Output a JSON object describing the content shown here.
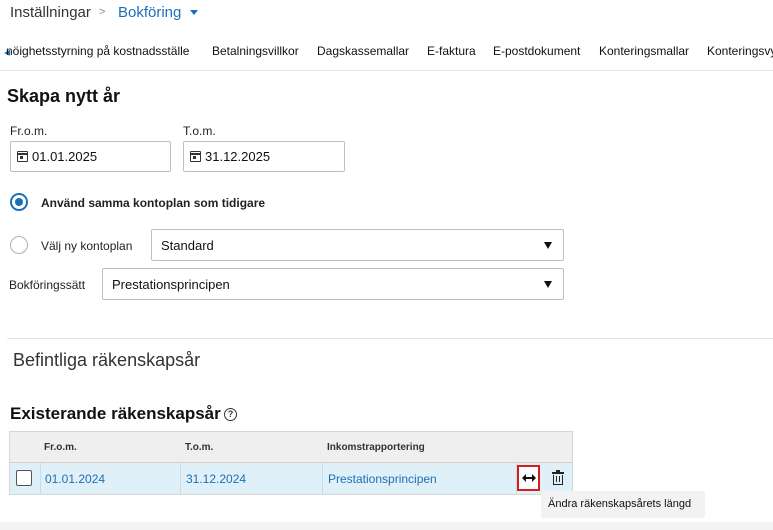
{
  "breadcrumb": {
    "root": "Inställningar",
    "separator": ">",
    "current": "Bokföring"
  },
  "tabs": [
    "nöighetsstyrning på kostnadsställe",
    "Betalningsvillkor",
    "Dagskassemallar",
    "E-faktura",
    "E-postdokument",
    "Konteringsmallar",
    "Konteringsvy"
  ],
  "create_year": {
    "title": "Skapa nytt år",
    "from_label": "Fr.o.m.",
    "from_value": "01.01.2025",
    "to_label": "T.o.m.",
    "to_value": "31.12.2025",
    "radio_same": "Använd samma kontoplan som tidigare",
    "radio_new": "Välj ny kontoplan",
    "kontoplan_value": "Standard",
    "method_label": "Bokföringssätt",
    "method_value": "Prestationsprincipen"
  },
  "existing": {
    "section_title": "Befintliga räkenskapsår",
    "title": "Existerande räkenskapsår",
    "help_glyph": "?",
    "columns": [
      "Fr.o.m.",
      "T.o.m.",
      "Inkomstrapportering"
    ],
    "rows": [
      {
        "from": "01.01.2024",
        "to": "31.12.2024",
        "reporting": "Prestationsprincipen"
      }
    ],
    "tooltip": "Ändra räkenskapsårets längd"
  },
  "colors": {
    "accent": "#1d6fb5",
    "highlight_row": "#dff0f8",
    "focus_border": "#d81c1c"
  },
  "icons": [
    "chevron-down-icon",
    "calendar-icon",
    "help-icon",
    "resize-icon",
    "trash-icon"
  ]
}
